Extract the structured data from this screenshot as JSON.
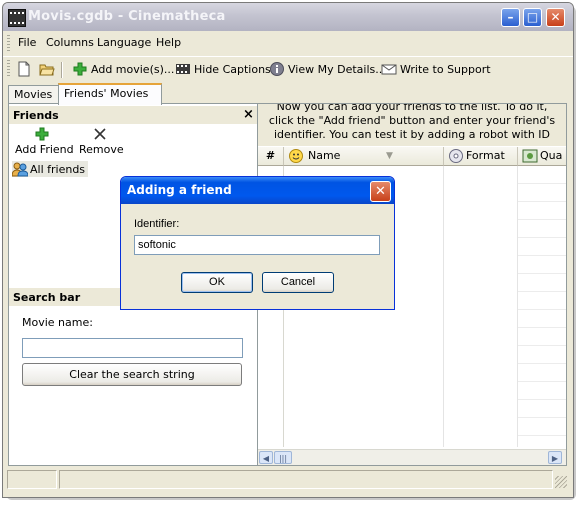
{
  "window": {
    "title": "Movis.cgdb - Cinematheca",
    "minimize_glyph": "–",
    "maximize_glyph": "□",
    "close_glyph": "✕"
  },
  "menu": [
    "File",
    "Columns",
    "Language",
    "Help"
  ],
  "toolbar": {
    "add_movies": "Add movie(s)...",
    "hide_captions": "Hide Captions",
    "view_details": "View My Details...",
    "write_support": "Write to Support"
  },
  "tabs": [
    "Movies",
    "Friends' Movies"
  ],
  "friends_panel": {
    "title": "Friends",
    "close_glyph": "×",
    "add_friend": "Add Friend",
    "remove": "Remove",
    "all_friends": "All friends"
  },
  "search_panel": {
    "title": "Search bar",
    "movie_name_label": "Movie name:",
    "movie_name_value": "",
    "clear_button": "Clear the search string"
  },
  "right_panel": {
    "info_lines": [
      "Now you can add your friends to the list. To do it,",
      "click the \"Add friend\" button and enter your friend's",
      "identifier. You can test it by adding a robot with ID"
    ],
    "columns": [
      "#",
      "Name",
      "Format",
      "Qua"
    ]
  },
  "dialog": {
    "title": "Adding a friend",
    "identifier_label": "Identifier:",
    "identifier_value": "softonic",
    "ok": "OK",
    "cancel": "Cancel",
    "close_glyph": "✕"
  },
  "colors": {
    "xp_blue": "#0054e3",
    "window_face": "#ece9d8",
    "tab_accent": "#e6a43a"
  }
}
